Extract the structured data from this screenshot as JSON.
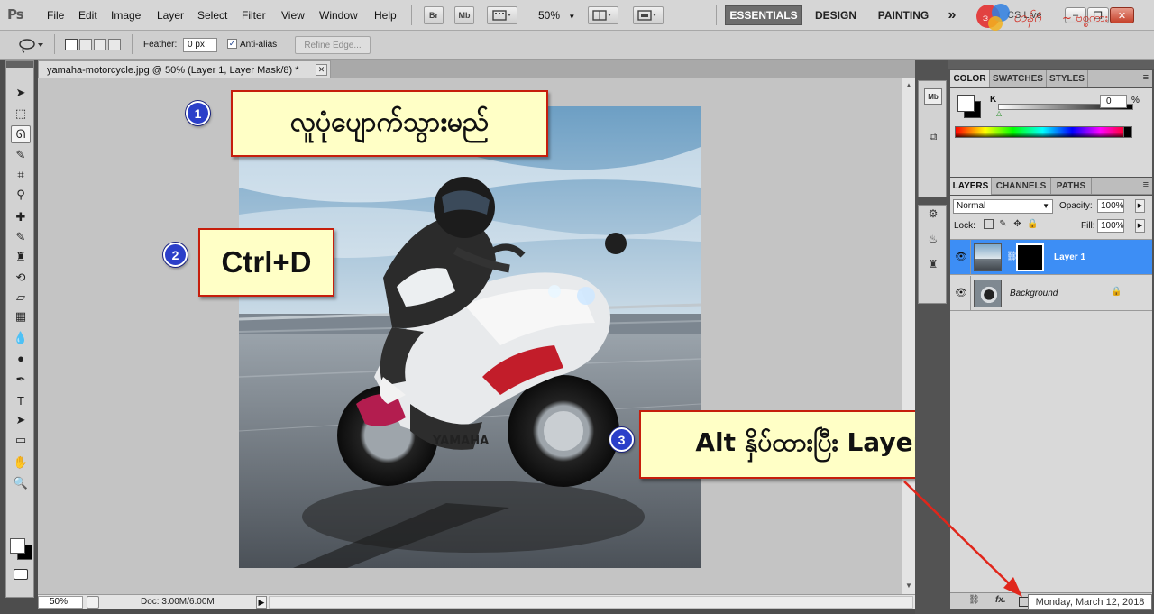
{
  "app": {
    "logo": "Ps",
    "menu": [
      "File",
      "Edit",
      "Image",
      "Layer",
      "Select",
      "Filter",
      "View",
      "Window",
      "Help"
    ],
    "bridge_label": "Br",
    "minibridge_label": "Mb",
    "zoom_level": "50%",
    "workspaces": [
      "ESSENTIALS",
      "DESIGN",
      "PAINTING"
    ],
    "workspaces_more": "»",
    "live_label": "CS Live",
    "window_buttons": [
      "–",
      "❐",
      "✕"
    ]
  },
  "options_bar": {
    "feather_label": "Feather:",
    "feather_value": "0 px",
    "antialias_label": "Anti-alias",
    "antialias_checked": true,
    "refine_edge_label": "Refine Edge..."
  },
  "tools": {
    "items": [
      {
        "icon": "move-tool-icon",
        "glyph": "➤"
      },
      {
        "icon": "marquee-tool-icon",
        "glyph": "⬚"
      },
      {
        "icon": "lasso-tool-icon",
        "glyph": "ᘏ"
      },
      {
        "icon": "quick-selection-tool-icon",
        "glyph": "✎"
      },
      {
        "icon": "crop-tool-icon",
        "glyph": "⌗"
      },
      {
        "icon": "eyedropper-tool-icon",
        "glyph": "⚲"
      },
      {
        "icon": "healing-brush-tool-icon",
        "glyph": "✚"
      },
      {
        "icon": "brush-tool-icon",
        "glyph": "✎"
      },
      {
        "icon": "clone-stamp-tool-icon",
        "glyph": "♜"
      },
      {
        "icon": "history-brush-tool-icon",
        "glyph": "⟲"
      },
      {
        "icon": "eraser-tool-icon",
        "glyph": "▱"
      },
      {
        "icon": "gradient-tool-icon",
        "glyph": "▦"
      },
      {
        "icon": "blur-tool-icon",
        "glyph": "💧"
      },
      {
        "icon": "dodge-tool-icon",
        "glyph": "●"
      },
      {
        "icon": "pen-tool-icon",
        "glyph": "✒"
      },
      {
        "icon": "type-tool-icon",
        "glyph": "T"
      },
      {
        "icon": "path-selection-tool-icon",
        "glyph": "➤"
      },
      {
        "icon": "shape-tool-icon",
        "glyph": "▭"
      },
      {
        "icon": "hand-tool-icon",
        "glyph": "✋"
      },
      {
        "icon": "zoom-tool-icon",
        "glyph": "🔍"
      }
    ],
    "active_index": 2
  },
  "document": {
    "tab_title": "yamaha-motorcycle.jpg @ 50% (Layer 1, Layer Mask/8) *",
    "close_glyph": "✕",
    "status_zoom": "50%",
    "doc_info": "Doc: 3.00M/6.00M",
    "status_arrow": "▶"
  },
  "annotations": [
    {
      "number": "1",
      "text": "လူပုံပျောက်သွားမည်"
    },
    {
      "number": "2",
      "text": "Ctrl+D"
    },
    {
      "number": "3",
      "text": "Alt နှိပ်ထားပြီး LayerMask နှိပ်"
    }
  ],
  "color_panel": {
    "tabs": [
      "COLOR",
      "SWATCHES",
      "STYLES"
    ],
    "active_tab": "COLOR",
    "k_label": "K",
    "k_value": "0",
    "k_unit": "%"
  },
  "layers_panel": {
    "tabs": [
      "LAYERS",
      "CHANNELS",
      "PATHS"
    ],
    "active_tab": "LAYERS",
    "blend_mode": "Normal",
    "opacity_label": "Opacity:",
    "opacity_value": "100%",
    "lock_label": "Lock:",
    "fill_label": "Fill:",
    "fill_value": "100%",
    "layers": [
      {
        "name": "Layer 1",
        "selected": true,
        "has_mask": true
      },
      {
        "name": "Background",
        "selected": false,
        "locked": true
      }
    ],
    "footer_icons": [
      "link-layers-icon",
      "fx-icon",
      "add-mask-icon"
    ],
    "fx_label": "fx."
  },
  "taskbar": {
    "date": "Monday, March 12, 2018"
  },
  "colors": {
    "selection_blue": "#3d8ef5",
    "callout_fill": "#ffffc6",
    "callout_border": "#c61e0c",
    "badge_blue": "#2b3fc9",
    "arrow_red": "#e0261b"
  }
}
